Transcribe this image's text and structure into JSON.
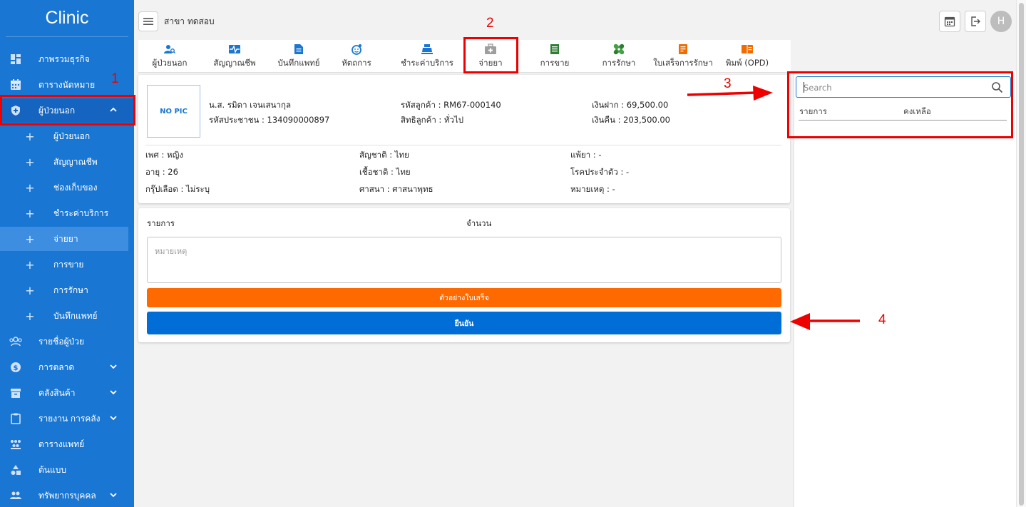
{
  "app": {
    "brand": "Clinic"
  },
  "sidebar": {
    "items": [
      {
        "label": "ภาพรวมธุรกิจ",
        "icon": "dashboard-icon"
      },
      {
        "label": "ตารางนัดหมาย",
        "icon": "calendar-icon"
      },
      {
        "label": "ผู้ป่วยนอก",
        "icon": "shield-icon",
        "expanded": true
      },
      {
        "label": "ผู้ป่วยนอก",
        "sub": true
      },
      {
        "label": "สัญญาณชีพ",
        "sub": true
      },
      {
        "label": "ช่องเก็บของ",
        "sub": true
      },
      {
        "label": "ชำระค่าบริการ",
        "sub": true
      },
      {
        "label": "จ่ายยา",
        "sub": true,
        "selected": true
      },
      {
        "label": "การขาย",
        "sub": true
      },
      {
        "label": "การรักษา",
        "sub": true
      },
      {
        "label": "บันทึกแพทย์",
        "sub": true
      },
      {
        "label": "รายชื่อผู้ป่วย",
        "icon": "patients-icon"
      },
      {
        "label": "การตลาด",
        "icon": "dollar-icon",
        "chevron": true
      },
      {
        "label": "คลังสินค้า",
        "icon": "warehouse-icon",
        "chevron": true
      },
      {
        "label": "รายงาน การคลัง",
        "icon": "clipboard-icon",
        "chevron": true
      },
      {
        "label": "ตารางแพทย์",
        "icon": "doctors-icon"
      },
      {
        "label": "ต้นแบบ",
        "icon": "shapes-icon"
      },
      {
        "label": "ทรัพยากรบุคคล",
        "icon": "people-icon",
        "chevron": true
      }
    ]
  },
  "header": {
    "branch": "สาขา ทดสอบ",
    "avatar_letter": "H"
  },
  "tabs": [
    {
      "label": "ผู้ป่วยนอก",
      "icon": "patient-search-icon",
      "color": "#1976d2"
    },
    {
      "label": "สัญญาณชีพ",
      "icon": "vitals-icon",
      "color": "#1976d2"
    },
    {
      "label": "บันทึกแพทย์",
      "icon": "document-icon",
      "color": "#1976d2"
    },
    {
      "label": "หัตถการ",
      "icon": "procedure-icon",
      "color": "#1976d2"
    },
    {
      "label": "ชำระค่าบริการ",
      "icon": "cash-register-icon",
      "color": "#1976d2"
    },
    {
      "label": "จ่ายยา",
      "icon": "medicine-kit-icon",
      "color": "#9e9e9e"
    },
    {
      "label": "การขาย",
      "icon": "receipt-icon",
      "color": "#2e7d32"
    },
    {
      "label": "การรักษา",
      "icon": "bandage-icon",
      "color": "#2e7d32"
    },
    {
      "label": "ใบเสร็จการรักษา",
      "icon": "invoice-icon",
      "color": "#ef6c00"
    },
    {
      "label": "พิมพ์ (OPD)",
      "icon": "print-book-icon",
      "color": "#ef6c00"
    }
  ],
  "patient": {
    "photo_placeholder": "NO PIC",
    "name": "น.ส. รมิดา เจนเสนากุล",
    "national_id": "รหัสประชาชน : 1340900008​97",
    "customer_code": "รหัสลูกค้า : RM67-000140",
    "customer_right": "สิทธิลูกค้า : ทั่วไป",
    "deposit": "เงินฝาก : 69,500.00",
    "refund": "เงินคืน : 203,500.00",
    "gender": "เพศ : หญิง",
    "age": "อายุ : 26",
    "blood": "กรุ๊ปเลือด : ไม่ระบุ",
    "nationality": "สัญชาติ : ไทย",
    "race": "เชื้อชาติ : ไทย",
    "religion": "ศาสนา : ศาสนาพุทธ",
    "allergy": "แพ้ยา : -",
    "disease": "โรคประจำตัว : -",
    "note": "หมายเหตุ : -"
  },
  "dispense": {
    "col_item": "รายการ",
    "col_qty": "จำนวน",
    "remark_placeholder": "หมายเหตุ",
    "preview_button": "ตัวอย่างใบเสร็จ",
    "confirm_button": "ยืนยัน"
  },
  "stock_panel": {
    "search_placeholder": "Search",
    "col_item": "รายการ",
    "col_remaining": "คงเหลือ"
  },
  "annotations": [
    "1",
    "2",
    "3",
    "4"
  ],
  "colors": {
    "sidebar": "#1976d2",
    "accent_orange": "#ff6a00",
    "confirm_blue": "#006ed6",
    "annotation_red": "#ee0000"
  }
}
